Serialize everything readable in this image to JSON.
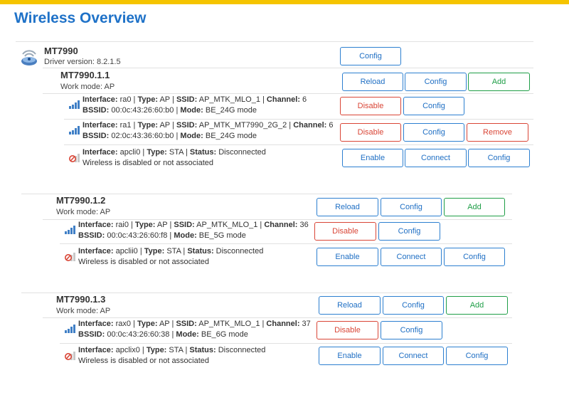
{
  "page": {
    "title": "Wireless Overview"
  },
  "device": {
    "name": "MT7990",
    "driver_version": "Driver version: 8.2.1.5",
    "config_label": "Config",
    "icon": "radio-device-icon"
  },
  "radios": [
    {
      "name": "MT7990.1.1",
      "work_mode": "Work mode: AP",
      "buttons": {
        "reload": "Reload",
        "config": "Config",
        "add": "Add"
      },
      "interfaces": [
        {
          "icon": "signal-icon",
          "line1": {
            "k_iface": "Interface:",
            "iface": "ra0",
            "k_type": "Type:",
            "type": "AP",
            "k_ssid": "SSID:",
            "ssid": "AP_MTK_MLO_1",
            "k_channel": "Channel:",
            "channel": "6"
          },
          "line2": {
            "k_bssid": "BSSID:",
            "bssid": "00:0c:43:26:60:b0",
            "k_mode": "Mode:",
            "mode": "BE_24G mode"
          },
          "buttons": {
            "disable": "Disable",
            "config": "Config"
          }
        },
        {
          "icon": "signal-icon",
          "line1": {
            "k_iface": "Interface:",
            "iface": "ra1",
            "k_type": "Type:",
            "type": "AP",
            "k_ssid": "SSID:",
            "ssid": "AP_MTK_MT7990_2G_2",
            "k_channel": "Channel:",
            "channel": "6"
          },
          "line2": {
            "k_bssid": "BSSID:",
            "bssid": "02:0c:43:36:60:b0",
            "k_mode": "Mode:",
            "mode": "BE_24G mode"
          },
          "buttons": {
            "disable": "Disable",
            "config": "Config",
            "remove": "Remove"
          }
        },
        {
          "icon": "disabled-icon",
          "line1": {
            "k_iface": "Interface:",
            "iface": "apcli0",
            "k_type": "Type:",
            "type": "STA",
            "k_status": "Status:",
            "status": "Disconnected"
          },
          "line2": {
            "text": "Wireless is disabled or not associated"
          },
          "buttons": {
            "enable": "Enable",
            "connect": "Connect",
            "config": "Config"
          }
        }
      ]
    },
    {
      "name": "MT7990.1.2",
      "work_mode": "Work mode: AP",
      "buttons": {
        "reload": "Reload",
        "config": "Config",
        "add": "Add"
      },
      "interfaces": [
        {
          "icon": "signal-icon",
          "line1": {
            "k_iface": "Interface:",
            "iface": "rai0",
            "k_type": "Type:",
            "type": "AP",
            "k_ssid": "SSID:",
            "ssid": "AP_MTK_MLO_1",
            "k_channel": "Channel:",
            "channel": "36"
          },
          "line2": {
            "k_bssid": "BSSID:",
            "bssid": "00:0c:43:26:60:f8",
            "k_mode": "Mode:",
            "mode": "BE_5G mode"
          },
          "buttons": {
            "disable": "Disable",
            "config": "Config"
          }
        },
        {
          "icon": "disabled-icon",
          "line1": {
            "k_iface": "Interface:",
            "iface": "apclii0",
            "k_type": "Type:",
            "type": "STA",
            "k_status": "Status:",
            "status": "Disconnected"
          },
          "line2": {
            "text": "Wireless is disabled or not associated"
          },
          "buttons": {
            "enable": "Enable",
            "connect": "Connect",
            "config": "Config"
          }
        }
      ]
    },
    {
      "name": "MT7990.1.3",
      "work_mode": "Work mode: AP",
      "buttons": {
        "reload": "Reload",
        "config": "Config",
        "add": "Add"
      },
      "interfaces": [
        {
          "icon": "signal-icon",
          "line1": {
            "k_iface": "Interface:",
            "iface": "rax0",
            "k_type": "Type:",
            "type": "AP",
            "k_ssid": "SSID:",
            "ssid": "AP_MTK_MLO_1",
            "k_channel": "Channel:",
            "channel": "37"
          },
          "line2": {
            "k_bssid": "BSSID:",
            "bssid": "00:0c:43:26:60:38",
            "k_mode": "Mode:",
            "mode": "BE_6G mode"
          },
          "buttons": {
            "disable": "Disable",
            "config": "Config"
          }
        },
        {
          "icon": "disabled-icon",
          "line1": {
            "k_iface": "Interface:",
            "iface": "apclix0",
            "k_type": "Type:",
            "type": "STA",
            "k_status": "Status:",
            "status": "Disconnected"
          },
          "line2": {
            "text": "Wireless is disabled or not associated"
          },
          "buttons": {
            "enable": "Enable",
            "connect": "Connect",
            "config": "Config"
          }
        }
      ]
    }
  ],
  "colors": {
    "accent": "#1f72c8",
    "add": "#1f9e47",
    "danger": "#d94536",
    "topbar": "#f5c400"
  }
}
